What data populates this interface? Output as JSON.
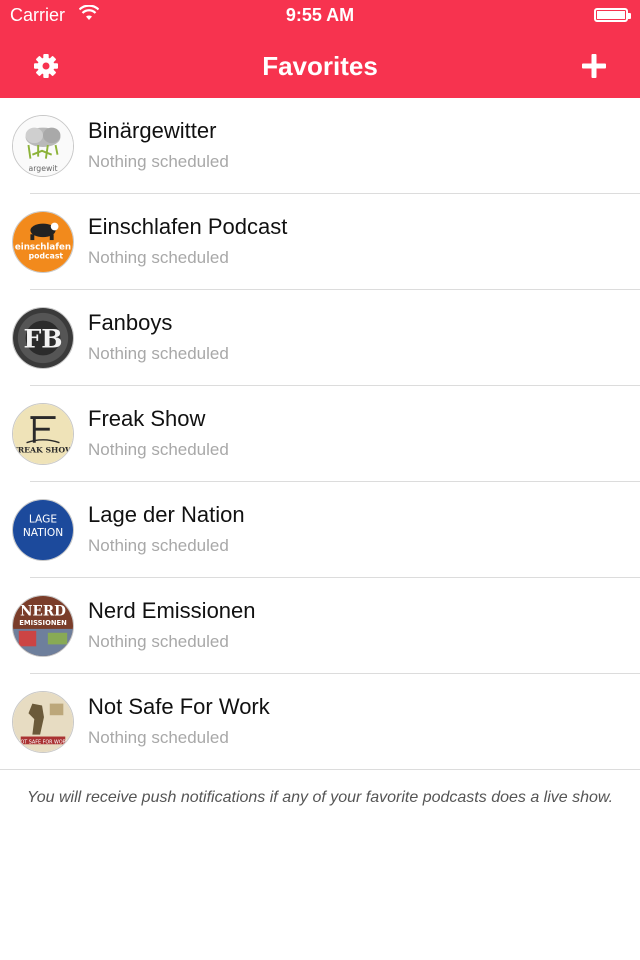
{
  "status_bar": {
    "carrier": "Carrier",
    "time": "9:55 AM",
    "wifi_icon": "wifi-icon",
    "battery_icon": "battery-icon"
  },
  "nav": {
    "title": "Favorites",
    "settings_icon": "gear-icon",
    "add_icon": "plus-icon",
    "accent_color": "#f7334f"
  },
  "favorites": [
    {
      "title": "Binärgewitter",
      "subtitle": "Nothing scheduled",
      "avatar_text": "argewit"
    },
    {
      "title": "Einschlafen Podcast",
      "subtitle": "Nothing scheduled",
      "avatar_text_1": "einschlafen",
      "avatar_text_2": "podcast"
    },
    {
      "title": "Fanboys",
      "subtitle": "Nothing scheduled",
      "avatar_text": "FB"
    },
    {
      "title": "Freak Show",
      "subtitle": "Nothing scheduled",
      "avatar_text": "FREAK SHOW"
    },
    {
      "title": "Lage der Nation",
      "subtitle": "Nothing scheduled",
      "avatar_text_1": "LAGE",
      "avatar_text_2": "NATION"
    },
    {
      "title": "Nerd Emissionen",
      "subtitle": "Nothing scheduled",
      "avatar_text_1": "NERD",
      "avatar_text_2": "EMISSIONEN"
    },
    {
      "title": "Not Safe For Work",
      "subtitle": "Nothing scheduled",
      "avatar_text": "NOT SAFE FOR WORK"
    }
  ],
  "footer": {
    "note": "You will receive push notifications if any of your favorite podcasts does a live show."
  }
}
